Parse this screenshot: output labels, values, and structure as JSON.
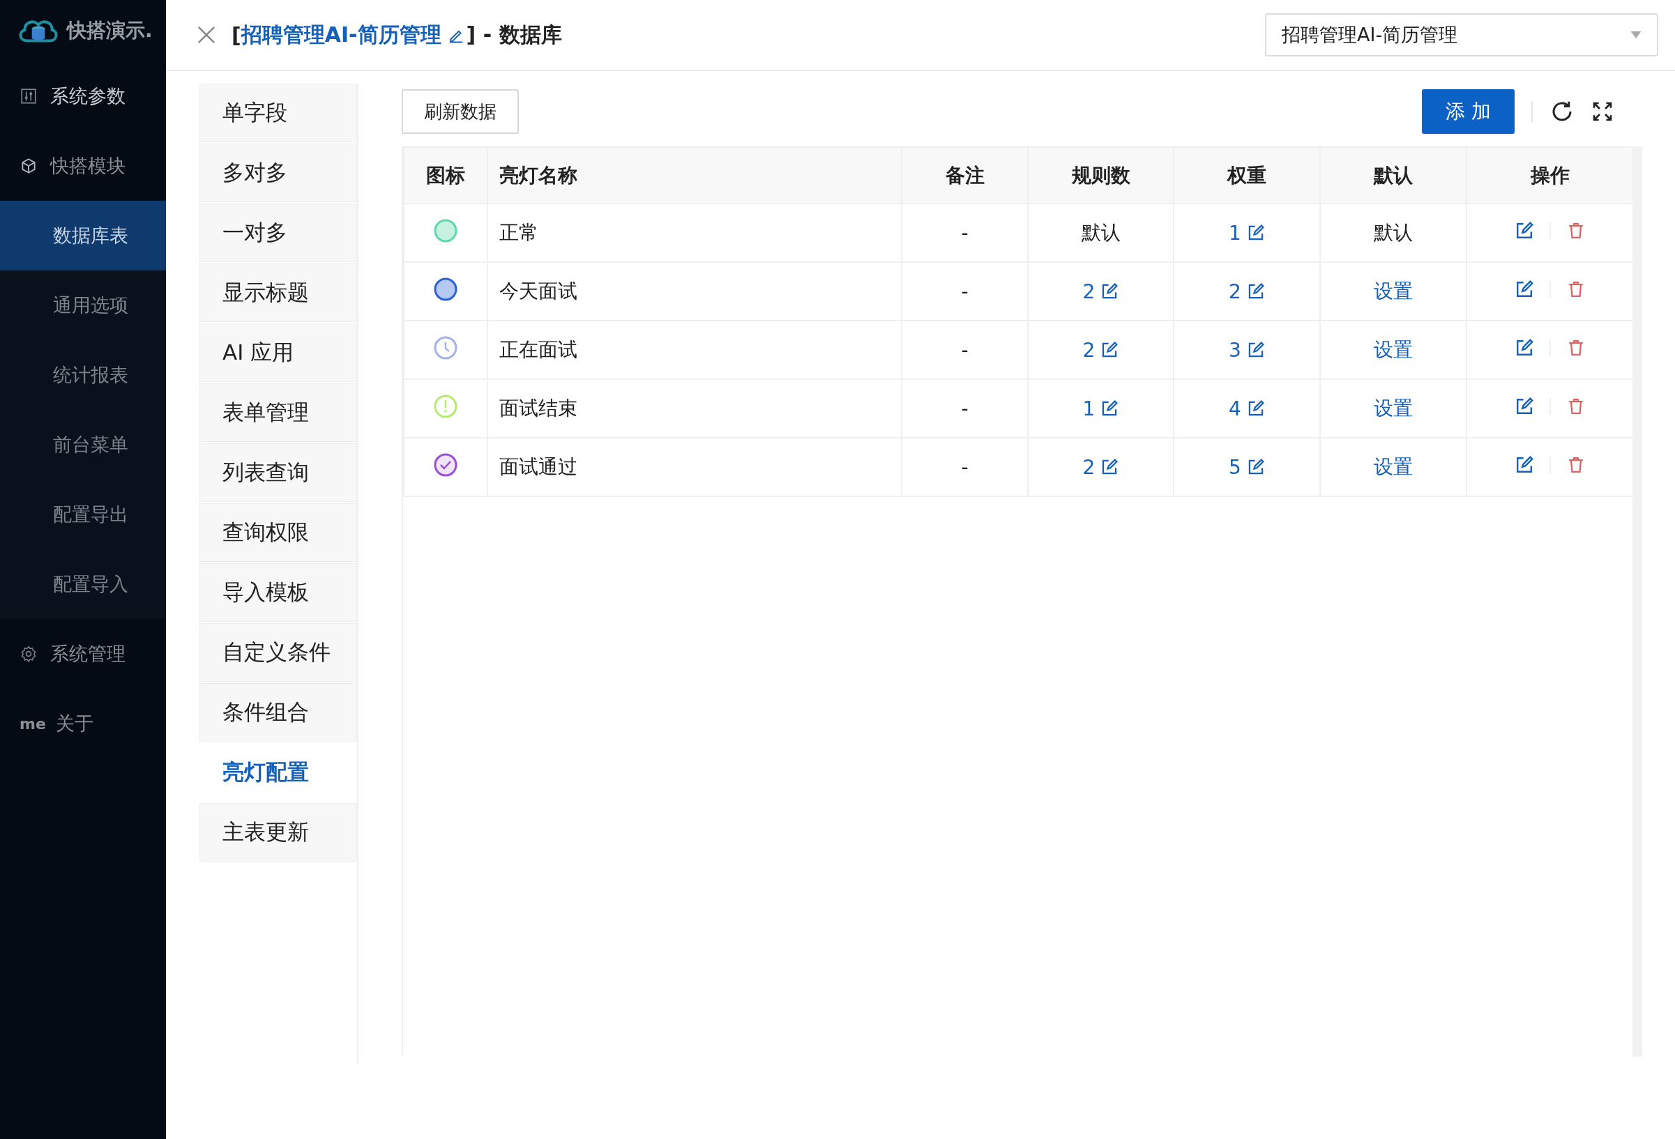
{
  "sidebar": {
    "brand": "快搭演示.",
    "items": [
      {
        "label": "系统参数",
        "kind": "sliders",
        "selected": false
      },
      {
        "label": "快搭模块",
        "kind": "cube",
        "selected": false,
        "children": [
          {
            "label": "数据库表",
            "selected": true
          },
          {
            "label": "通用选项",
            "selected": false
          },
          {
            "label": "统计报表",
            "selected": false
          },
          {
            "label": "前台菜单",
            "selected": false
          },
          {
            "label": "配置导出",
            "selected": false
          },
          {
            "label": "配置导入",
            "selected": false
          }
        ]
      },
      {
        "label": "系统管理",
        "kind": "gear",
        "selected": false
      },
      {
        "label": "关于",
        "kind": "text",
        "icon_text": "me",
        "selected": false
      }
    ]
  },
  "header": {
    "open_bracket": "[",
    "project": "招聘管理AI-简历管理",
    "suffix": "] - 数据库",
    "select_value": "招聘管理AI-简历管理"
  },
  "tabs": [
    {
      "label": "单字段",
      "selected": false
    },
    {
      "label": "多对多",
      "selected": false
    },
    {
      "label": "一对多",
      "selected": false
    },
    {
      "label": "显示标题",
      "selected": false
    },
    {
      "label": "AI 应用",
      "selected": false
    },
    {
      "label": "表单管理",
      "selected": false
    },
    {
      "label": "列表查询",
      "selected": false
    },
    {
      "label": "查询权限",
      "selected": false
    },
    {
      "label": "导入模板",
      "selected": false
    },
    {
      "label": "自定义条件",
      "selected": false
    },
    {
      "label": "条件组合",
      "selected": false
    },
    {
      "label": "亮灯配置",
      "selected": true
    },
    {
      "label": "主表更新",
      "selected": false
    }
  ],
  "toolbar": {
    "refresh_button": "刷新数据",
    "add_button": "添 加"
  },
  "table": {
    "columns": [
      "图标",
      "亮灯名称",
      "备注",
      "规则数",
      "权重",
      "默认",
      "操作"
    ],
    "rows": [
      {
        "icon": {
          "kind": "dot",
          "color": "#5fd8a8"
        },
        "name": "正常",
        "note": "-",
        "rules": {
          "text": "默认",
          "editable": false
        },
        "weight": {
          "text": "1",
          "editable": true
        },
        "default": {
          "text": "默认",
          "link": false
        }
      },
      {
        "icon": {
          "kind": "dot",
          "color": "#2a62d6"
        },
        "name": "今天面试",
        "note": "-",
        "rules": {
          "text": "2",
          "editable": true
        },
        "weight": {
          "text": "2",
          "editable": true
        },
        "default": {
          "text": "设置",
          "link": true
        }
      },
      {
        "icon": {
          "kind": "clock",
          "color": "#a3b3ea"
        },
        "name": "正在面试",
        "note": "-",
        "rules": {
          "text": "2",
          "editable": true
        },
        "weight": {
          "text": "3",
          "editable": true
        },
        "default": {
          "text": "设置",
          "link": true
        }
      },
      {
        "icon": {
          "kind": "alert",
          "color": "#b6ea6e"
        },
        "name": "面试结束",
        "note": "-",
        "rules": {
          "text": "1",
          "editable": true
        },
        "weight": {
          "text": "4",
          "editable": true
        },
        "default": {
          "text": "设置",
          "link": true
        }
      },
      {
        "icon": {
          "kind": "check",
          "color": "#9a4fd8"
        },
        "name": "面试通过",
        "note": "-",
        "rules": {
          "text": "2",
          "editable": true
        },
        "weight": {
          "text": "5",
          "editable": true
        },
        "default": {
          "text": "设置",
          "link": true
        }
      }
    ]
  }
}
